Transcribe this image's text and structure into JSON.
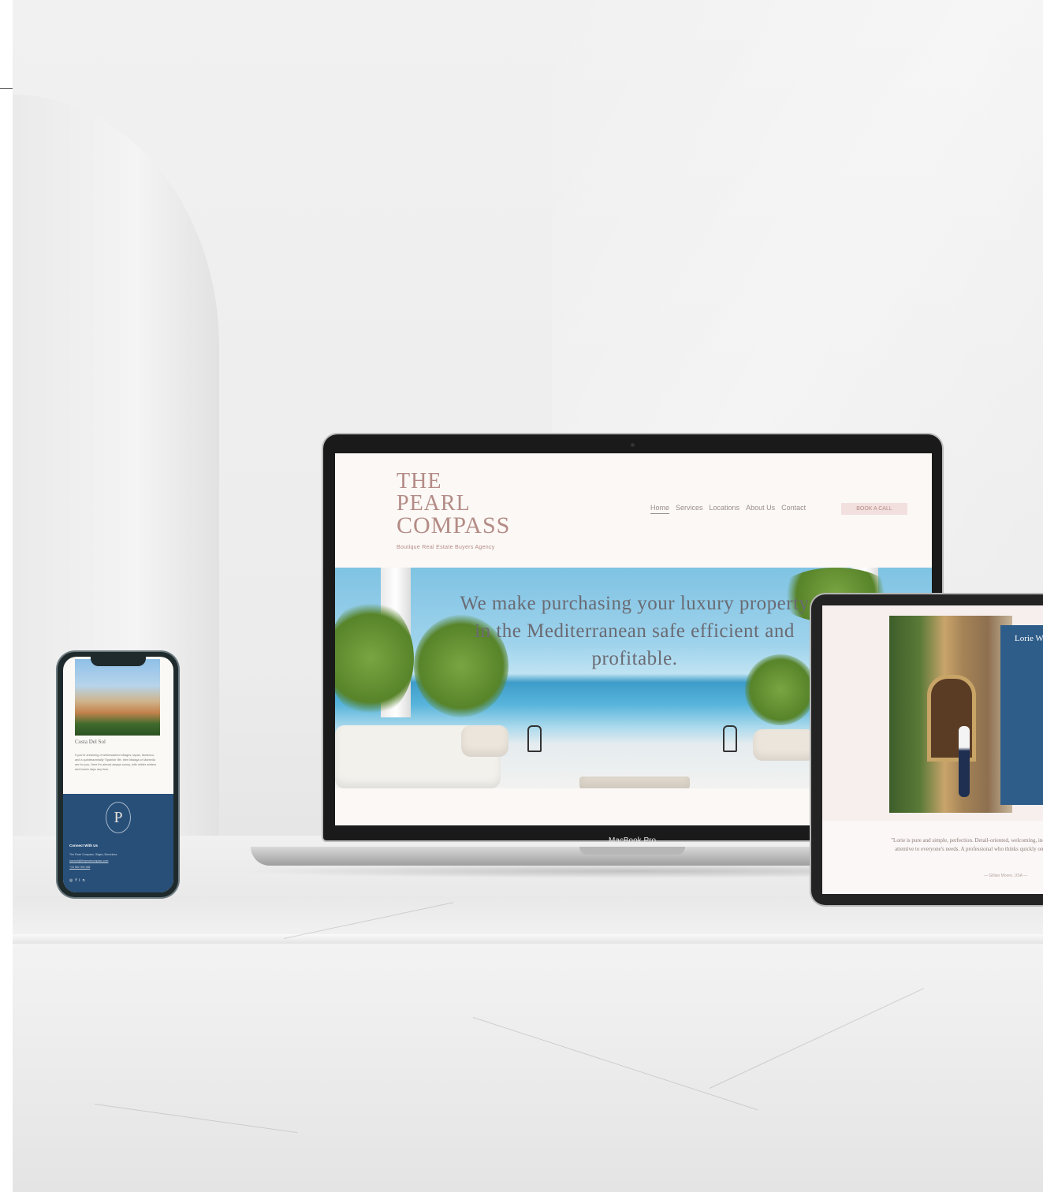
{
  "laptop": {
    "label": "MacBook Pro",
    "site": {
      "logo": {
        "line1": "THE PEARL",
        "line2": "COMPASS",
        "tagline": "Boutique Real Estate Buyers Agency"
      },
      "nav": [
        "Home",
        "Services",
        "Locations",
        "About Us",
        "Contact"
      ],
      "active_nav": "Home",
      "cta": "BOOK A CALL",
      "hero_headline": "We make purchasing your luxury property in the Mediterranean safe efficient and profitable."
    }
  },
  "phone": {
    "section_title": "Costa Del Sol",
    "body": "If you're dreaming of whitewashed villages, tapas, flamenco, and a quintessentially 'Spanish' life, then Malaga or Marbella are for you. Here it's almost always sunny, with milder winters and beach days any time.",
    "monogram": "P",
    "footer_heading": "Connect With Us",
    "footer_lines": [
      "The Pearl Compass, Sitges, Barcelona",
      "hannah@thepearlcompass.com",
      "+34 682 990 368"
    ],
    "social": [
      "◎",
      "f",
      "in"
    ]
  },
  "tablet": {
    "panel_title": "Lorie W",
    "quote": "\"Lorie is pure and simple, perfection. Detail-oriented, welcoming, inclusive, and attentive to everyone's needs. A professional who thinks quickly on her feet.\"",
    "author": "— Gillian Moore, USA —"
  },
  "colors": {
    "accent_pink": "#b48b86",
    "navy": "#274f78",
    "panel_blue": "#2f5d8a"
  }
}
